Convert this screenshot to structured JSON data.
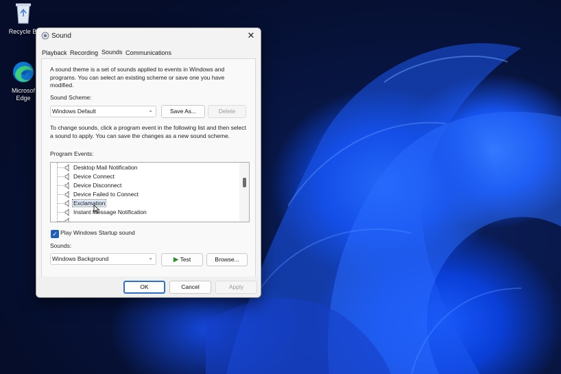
{
  "desktop": {
    "icons": [
      {
        "label": "Recycle Bi",
        "icon": "recycle-bin-icon"
      },
      {
        "label": "Microsof\nEdge",
        "icon": "edge-icon"
      }
    ]
  },
  "dialog": {
    "title": "Sound",
    "close_symbol": "✕",
    "tabs": [
      {
        "label": "Playback",
        "active": false
      },
      {
        "label": "Recording",
        "active": false
      },
      {
        "label": "Sounds",
        "active": true
      },
      {
        "label": "Communications",
        "active": false
      }
    ],
    "intro_text": "A sound theme is a set of sounds applied to events in Windows and programs.  You can select an existing scheme or save one you have modified.",
    "scheme": {
      "label": "Sound Scheme:",
      "value": "Windows Default",
      "save_as": "Save As...",
      "delete": "Delete"
    },
    "change_text": "To change sounds, click a program event in the following list and then select a sound to apply.  You can save the changes as a new sound scheme.",
    "events": {
      "label": "Program Events:",
      "items": [
        {
          "label": "Desktop Mail Notification",
          "selected": false
        },
        {
          "label": "Device Connect",
          "selected": false
        },
        {
          "label": "Device Disconnect",
          "selected": false
        },
        {
          "label": "Device Failed to Connect",
          "selected": false
        },
        {
          "label": "Exclamation",
          "selected": true
        },
        {
          "label": "Instant Message Notification",
          "selected": false
        }
      ]
    },
    "startup_checkbox": {
      "label": "Play Windows Startup sound",
      "checked": true
    },
    "sounds": {
      "label": "Sounds:",
      "value": "Windows Background",
      "test": "Test",
      "browse": "Browse..."
    },
    "footer": {
      "ok": "OK",
      "cancel": "Cancel",
      "apply": "Apply"
    }
  },
  "colors": {
    "accent": "#1f5fb8",
    "selection": "#dce8f6",
    "test_icon": "#2f8f2f"
  }
}
